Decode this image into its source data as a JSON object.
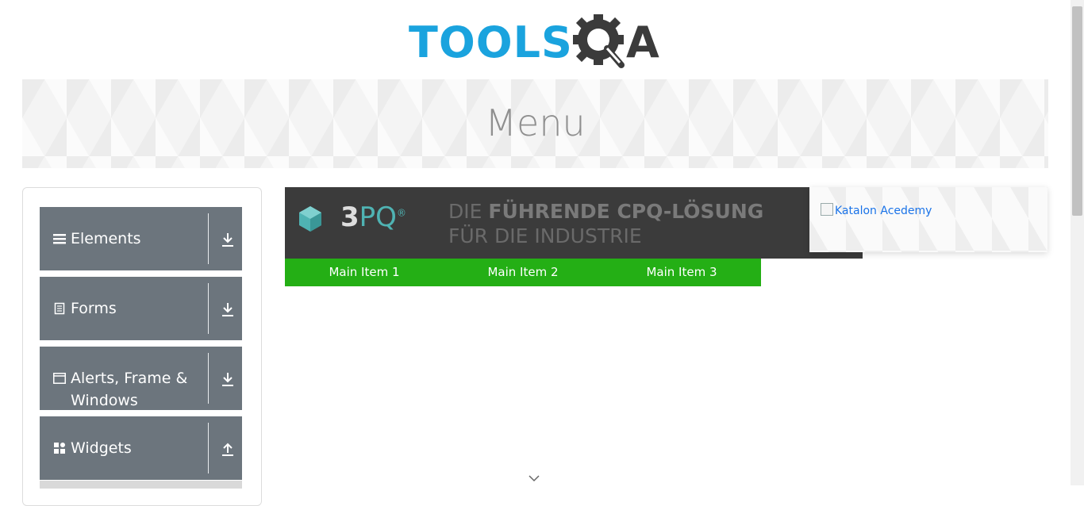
{
  "header": {
    "logo_text_primary": "TOOLS",
    "logo_text_secondary": "A",
    "logo_icon": "gear-magnifier-icon",
    "colors": {
      "primary": "#1aa3de",
      "secondary": "#3b3b3b"
    }
  },
  "banner": {
    "title": "Menu"
  },
  "sidebar": {
    "groups": [
      {
        "label": "Elements",
        "icon": "hamburger-icon",
        "arrow": "download-arrow-icon"
      },
      {
        "label": "Forms",
        "icon": "document-icon",
        "arrow": "download-arrow-icon"
      },
      {
        "label": "Alerts, Frame & Windows",
        "icon": "window-icon",
        "arrow": "download-arrow-icon"
      },
      {
        "label": "Widgets",
        "icon": "widgets-icon",
        "arrow": "upload-arrow-icon"
      }
    ],
    "group_color": "#6c757d"
  },
  "ad": {
    "brand": "3",
    "brand_accent": "PQ",
    "brand_mark": "®",
    "line1_prefix": "DIE ",
    "line1_bold": "FÜHRENDE CPQ-LÖSUNG",
    "line2": "FÜR DIE INDUSTRIE"
  },
  "menu": {
    "items": [
      "Main Item 1",
      "Main Item 2",
      "Main Item 3"
    ],
    "color": "#24af15"
  },
  "side_card": {
    "alt_text": "Katalon Acedemy"
  }
}
